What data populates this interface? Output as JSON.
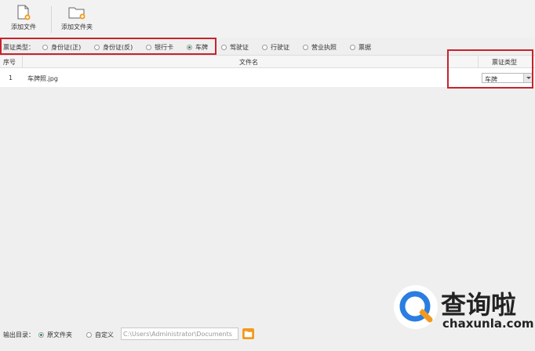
{
  "toolbar": {
    "add_file_label": "添加文件",
    "add_folder_label": "添加文件夹"
  },
  "doc_type": {
    "label": "票证类型：",
    "options": [
      "身份证(正)",
      "身份证(反)",
      "银行卡",
      "车牌",
      "驾驶证",
      "行驶证",
      "营业执照",
      "票据"
    ],
    "selected": "车牌"
  },
  "table": {
    "headers": {
      "seq": "序号",
      "filename": "文件名",
      "type": "票证类型"
    },
    "rows": [
      {
        "seq": "1",
        "filename": "车牌照.jpg",
        "type": "车牌"
      }
    ]
  },
  "output": {
    "label": "输出目录：",
    "option_original": "原文件夹",
    "option_custom": "自定义",
    "selected": "原文件夹",
    "path_value": "C:\\Users\\Administrator\\Documents"
  },
  "watermark": {
    "text": "查询啦",
    "url": "chaxunla.com"
  },
  "colors": {
    "highlight": "#c8232c",
    "accent": "#f29a1f",
    "radio_selected": "#2e8b57"
  }
}
